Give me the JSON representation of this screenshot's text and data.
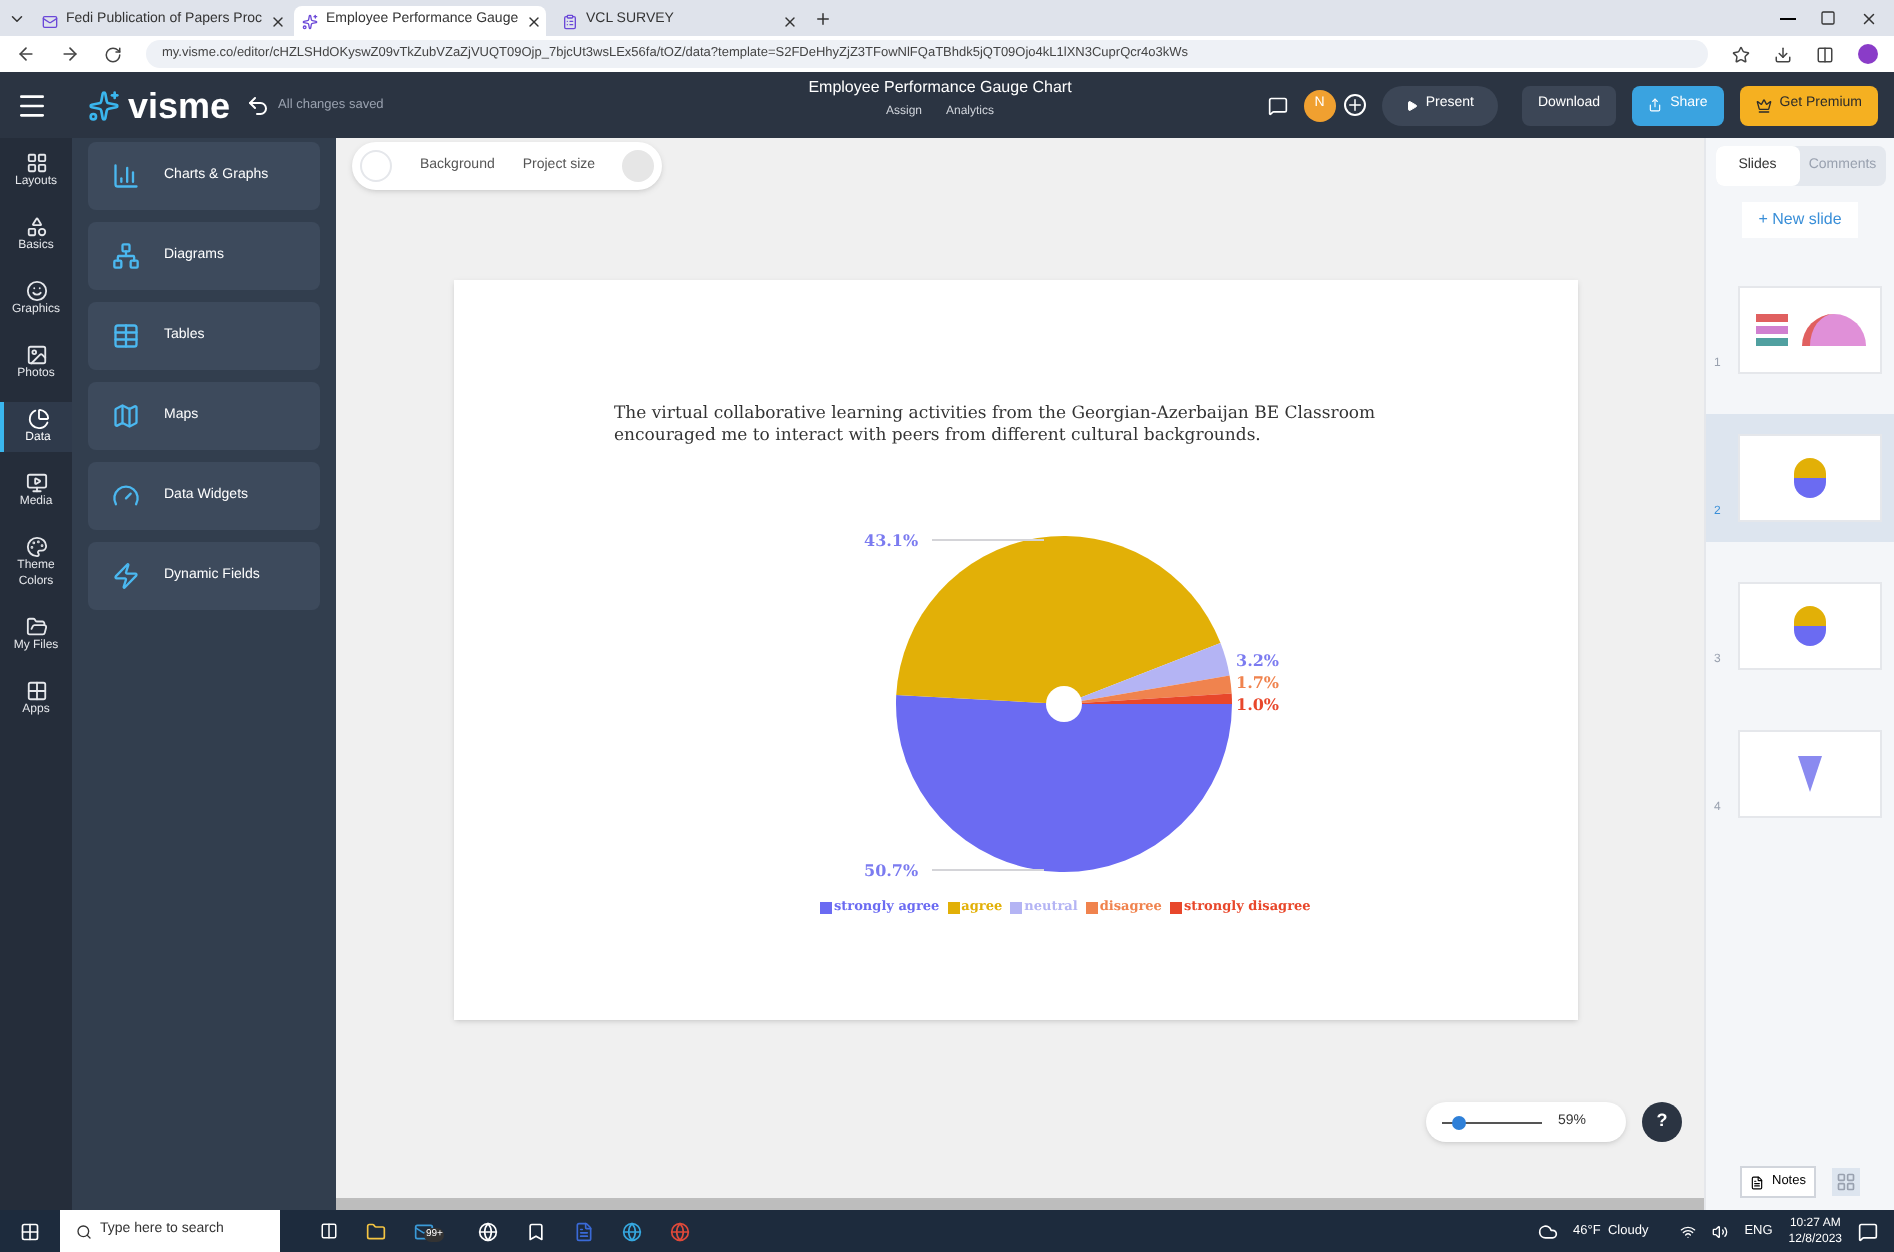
{
  "browser": {
    "tabs": [
      {
        "title": "Fedi Publication of Papers Proc",
        "selected": false,
        "kind": "mail"
      },
      {
        "title": "Employee Performance Gauge",
        "selected": true,
        "kind": "visme"
      },
      {
        "title": "VCL SURVEY",
        "selected": false,
        "kind": "form"
      }
    ],
    "url": "my.visme.co/editor/cHZLSHdOKyswZ09vTkZubVZaZjVUQT09Ojp_7bjcUt3wsLEx56fa/tOZ/data?template=S2FDeHhyZjZ3TFowNlFQaTBhdk5jQT09Ojo4kL1lXN3CuprQcr4o3kWs"
  },
  "header": {
    "logo": "visme",
    "saved": "All changes saved",
    "title": "Employee Performance Gauge Chart",
    "actions": [
      "Assign",
      "Analytics"
    ],
    "avatar": "N",
    "present": "Present",
    "download": "Download",
    "share": "Share",
    "premium": "Get Premium"
  },
  "rail": [
    {
      "label": "Layouts",
      "selected": false,
      "kind": "layouts"
    },
    {
      "label": "Basics",
      "selected": false,
      "kind": "basics"
    },
    {
      "label": "Graphics",
      "selected": false,
      "kind": "graphics"
    },
    {
      "label": "Photos",
      "selected": false,
      "kind": "photos"
    },
    {
      "label": "Data",
      "selected": true,
      "kind": "data"
    },
    {
      "label": "Media",
      "selected": false,
      "kind": "media"
    },
    {
      "label": "Theme Colors",
      "selected": false,
      "kind": "theme"
    },
    {
      "label": "My Files",
      "selected": false,
      "kind": "files"
    },
    {
      "label": "Apps",
      "selected": false,
      "kind": "apps"
    }
  ],
  "panel": [
    {
      "label": "Charts & Graphs",
      "kind": "charts"
    },
    {
      "label": "Diagrams",
      "kind": "diagrams"
    },
    {
      "label": "Tables",
      "kind": "tables"
    },
    {
      "label": "Maps",
      "kind": "maps"
    },
    {
      "label": "Data Widgets",
      "kind": "widgets"
    },
    {
      "label": "Dynamic Fields",
      "kind": "fields"
    }
  ],
  "toolbar": [
    "Background",
    "Project size"
  ],
  "slide": {
    "title": "The virtual collaborative learning activities from the Georgian-Azerbaijan BE Classroom encouraged me to interact with peers from different cultural backgrounds.",
    "chart_data": {
      "type": "pie",
      "categories": [
        "strongly agree",
        "agree",
        "neutral",
        "disagree",
        "strongly disagree"
      ],
      "series": [
        {
          "values": [
            50.7,
            43.1,
            3.2,
            1.7,
            1.0
          ],
          "colors": [
            "#6b6bf2",
            "#e2b007",
            "#b4b4f4",
            "#f0834e",
            "#e8472b"
          ]
        }
      ],
      "value_labels": [
        "50.7%",
        "43.1%",
        "3.2%",
        "1.7%",
        "1.0%"
      ]
    }
  },
  "sidebar": {
    "tabs": [
      {
        "label": "Slides",
        "selected": true
      },
      {
        "label": "Comments",
        "selected": false
      }
    ],
    "new_slide": "+ New slide",
    "slides": [
      {
        "number": "1",
        "selected": false,
        "kind": "gauge"
      },
      {
        "number": "2",
        "selected": true,
        "kind": "pie"
      },
      {
        "number": "3",
        "selected": false,
        "kind": "pie"
      },
      {
        "number": "4",
        "selected": false,
        "kind": "funnel"
      }
    ],
    "notes": "Notes"
  },
  "zoom": {
    "level": 0.1,
    "reading": "59%",
    "help": "?"
  },
  "taskbar": {
    "search": "Type here to search",
    "badge": "99+",
    "weather": "46°F  Cloudy",
    "lang": "ENG",
    "time": "10:27 AM",
    "date": "12/8/2023"
  }
}
